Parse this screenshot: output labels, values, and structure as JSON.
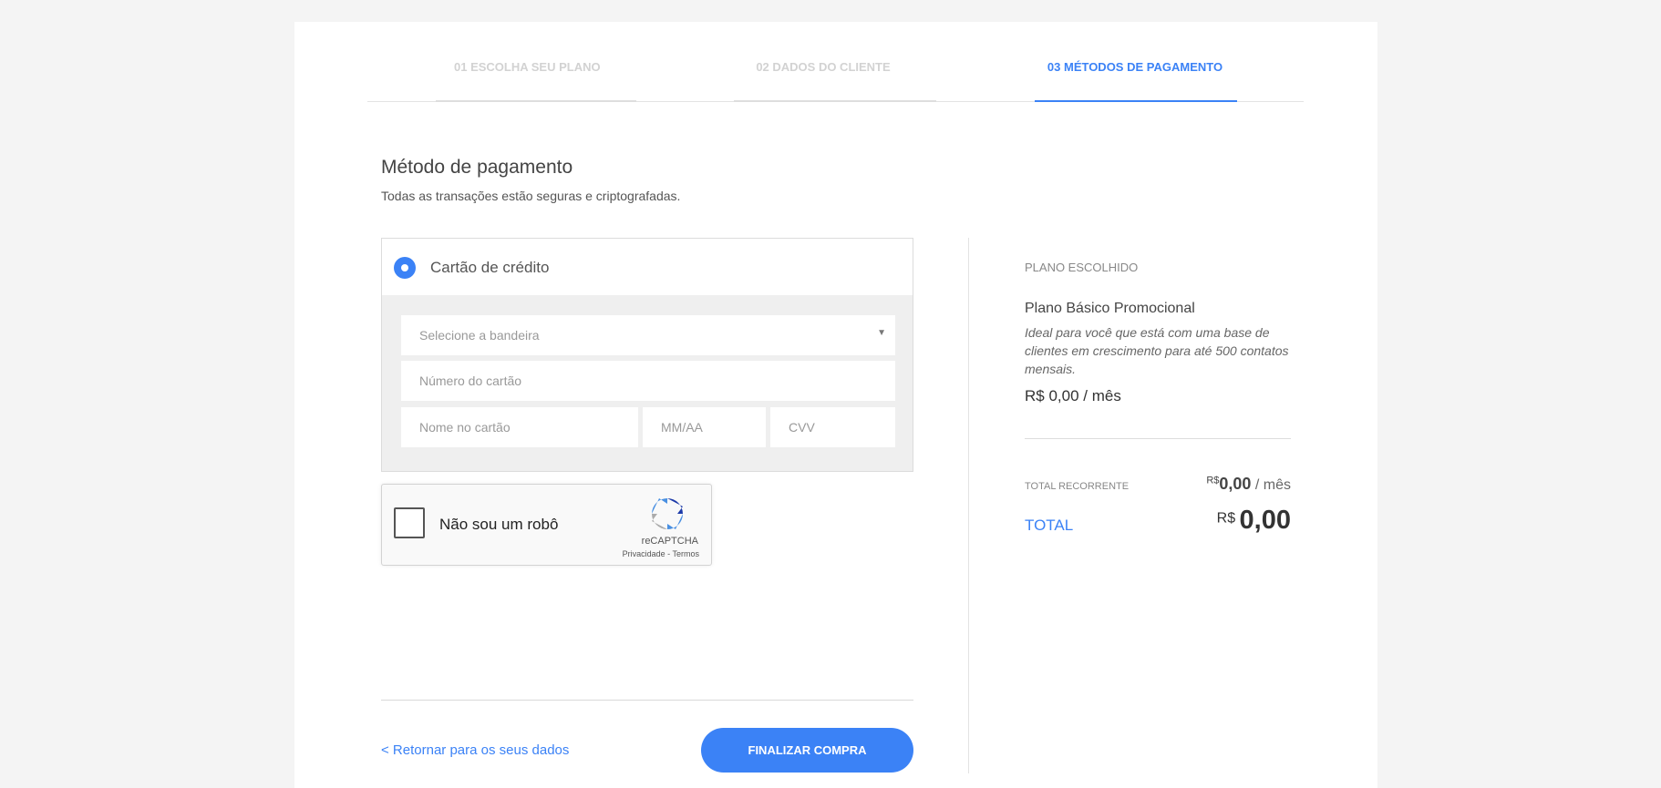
{
  "steps": [
    {
      "label": "01 ESCOLHA SEU PLANO",
      "active": false
    },
    {
      "label": "02 DADOS DO CLIENTE",
      "active": false
    },
    {
      "label": "03 MÉTODOS DE PAGAMENTO",
      "active": true
    }
  ],
  "colors": {
    "accent": "#3b82f6",
    "inactive_step": "#d2d2d2"
  },
  "main": {
    "title": "Método de pagamento",
    "subtitle": "Todas as transações estão seguras e criptografadas."
  },
  "payment": {
    "option_label": "Cartão de crédito",
    "selected": true,
    "brand_select_placeholder": "Selecione a bandeira",
    "card_number_placeholder": "Número do cartão",
    "card_name_placeholder": "Nome no cartão",
    "expiry_placeholder": "MM/AA",
    "cvv_placeholder": "CVV"
  },
  "captcha": {
    "label": "Não sou um robô",
    "brand": "reCAPTCHA",
    "privacy": "Privacidade",
    "separator": "-",
    "terms": "Termos"
  },
  "footer": {
    "back_link": "< Retornar para os seus dados",
    "finish_button": "FINALIZAR COMPRA"
  },
  "summary": {
    "heading": "PLANO ESCOLHIDO",
    "plan_name": "Plano Básico Promocional",
    "plan_description": "Ideal para você que está com uma base de clientes em crescimento para até 500 contatos mensais.",
    "plan_price": "R$ 0,00 / mês",
    "recurring_label": "TOTAL RECORRENTE",
    "recurring_currency": "R$",
    "recurring_amount": "0,00",
    "recurring_period": "/ mês",
    "total_label": "TOTAL",
    "total_currency": "R$",
    "total_amount": "0,00"
  }
}
